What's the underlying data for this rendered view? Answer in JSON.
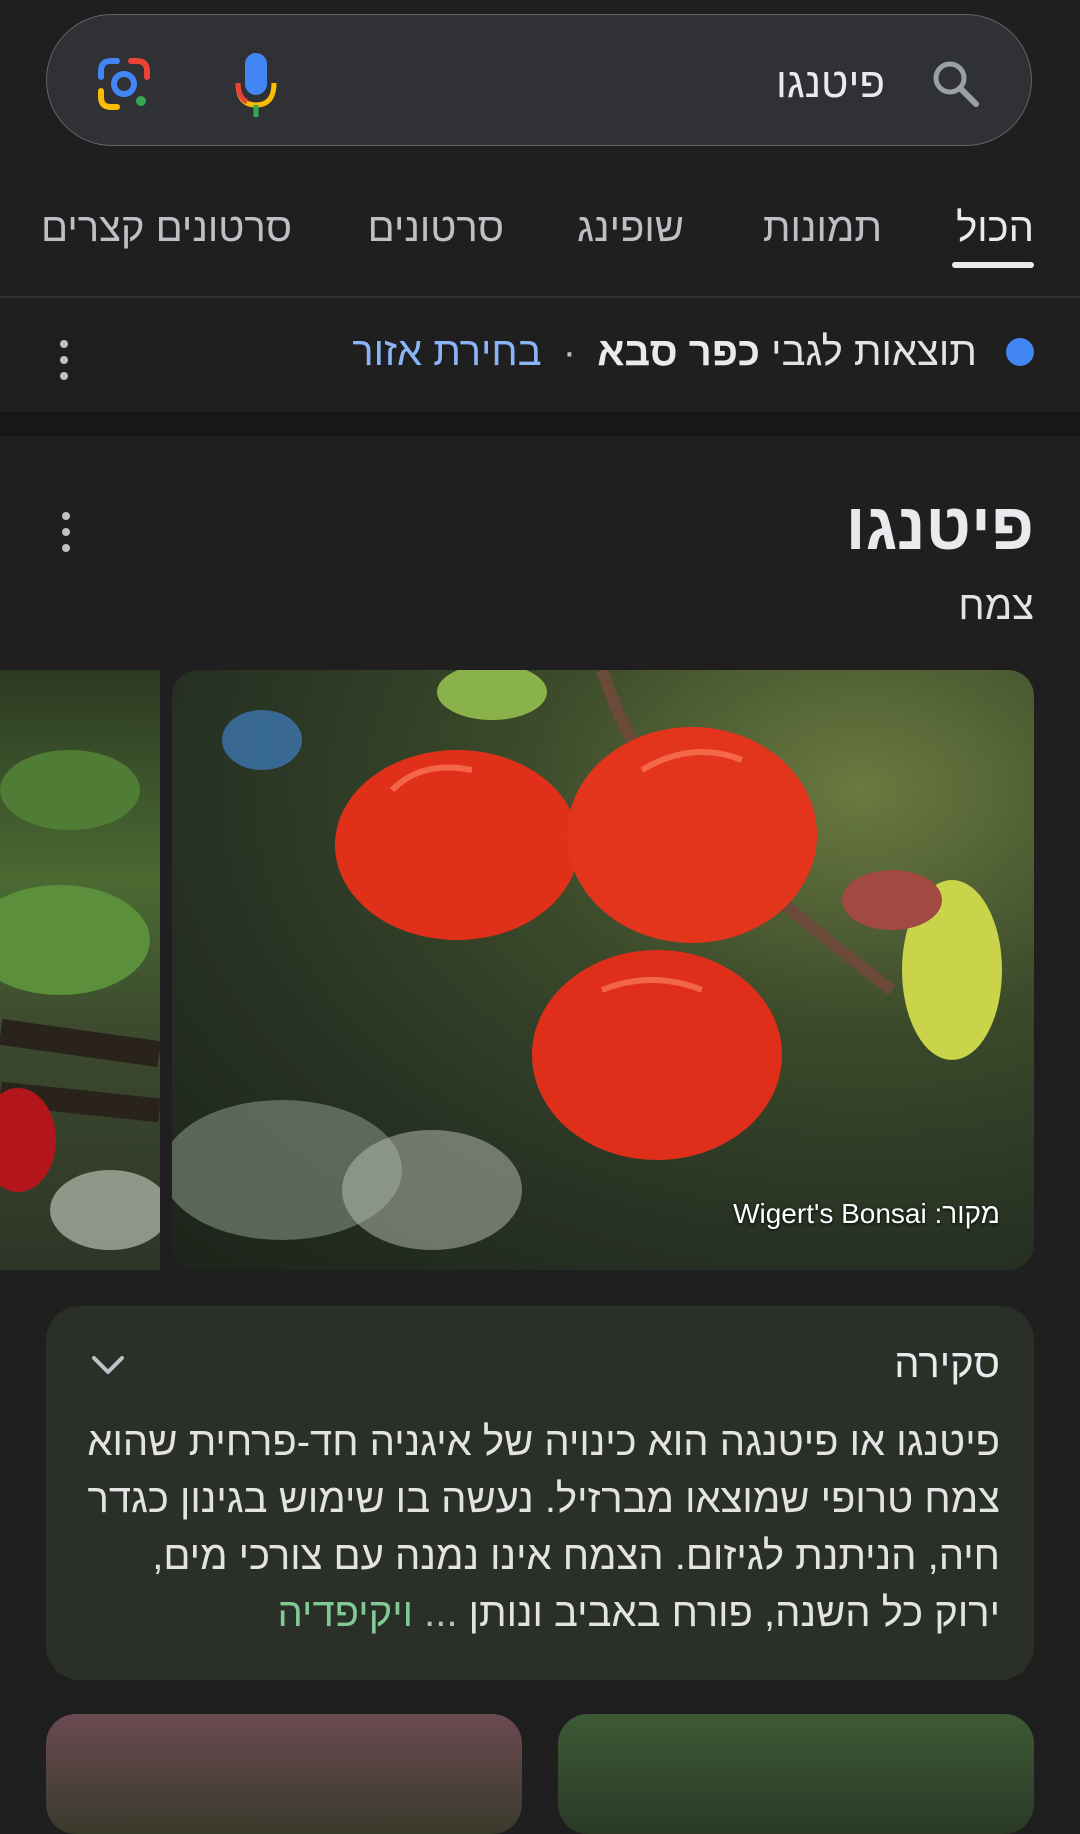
{
  "search": {
    "query": "פיטנגו"
  },
  "tabs": [
    {
      "label": "הכול",
      "active": true
    },
    {
      "label": "תמונות",
      "active": false
    },
    {
      "label": "שופינג",
      "active": false
    },
    {
      "label": "סרטונים",
      "active": false
    },
    {
      "label": "סרטונים קצרים",
      "active": false
    }
  ],
  "location": {
    "prefix": "תוצאות לגבי",
    "place": "כפר סבא",
    "separator": "·",
    "change_link": "בחירת אזור"
  },
  "knowledge_panel": {
    "title": "פיטנגו",
    "subtitle": "צמח",
    "image_caption": "מקור: Wigert's Bonsai"
  },
  "about": {
    "title": "סקירה",
    "text": "פיטנגו או פיטנגה הוא כינויה של איגניה חד-פרחית שהוא צמח טרופי שמוצאו מברזיל. נעשה בו שימוש בגינון כגדר חיה, הניתנת לגיזום. הצמח אינו נמנה עם צורכי מים, ירוק כל השנה, פורח באביב ונותן",
    "ellipsis": "...",
    "source_link": "ויקיפדיה"
  },
  "colors": {
    "background": "#1f1f1f",
    "link_blue": "#8ab4f8",
    "location_dot": "#4285f4",
    "wiki_green": "#81c995",
    "card_bg": "#2a2f28"
  },
  "icons": {
    "search": "search-icon",
    "mic": "mic-icon",
    "lens": "google-lens-icon",
    "more": "more-vert-icon",
    "chevron": "chevron-down-icon"
  }
}
